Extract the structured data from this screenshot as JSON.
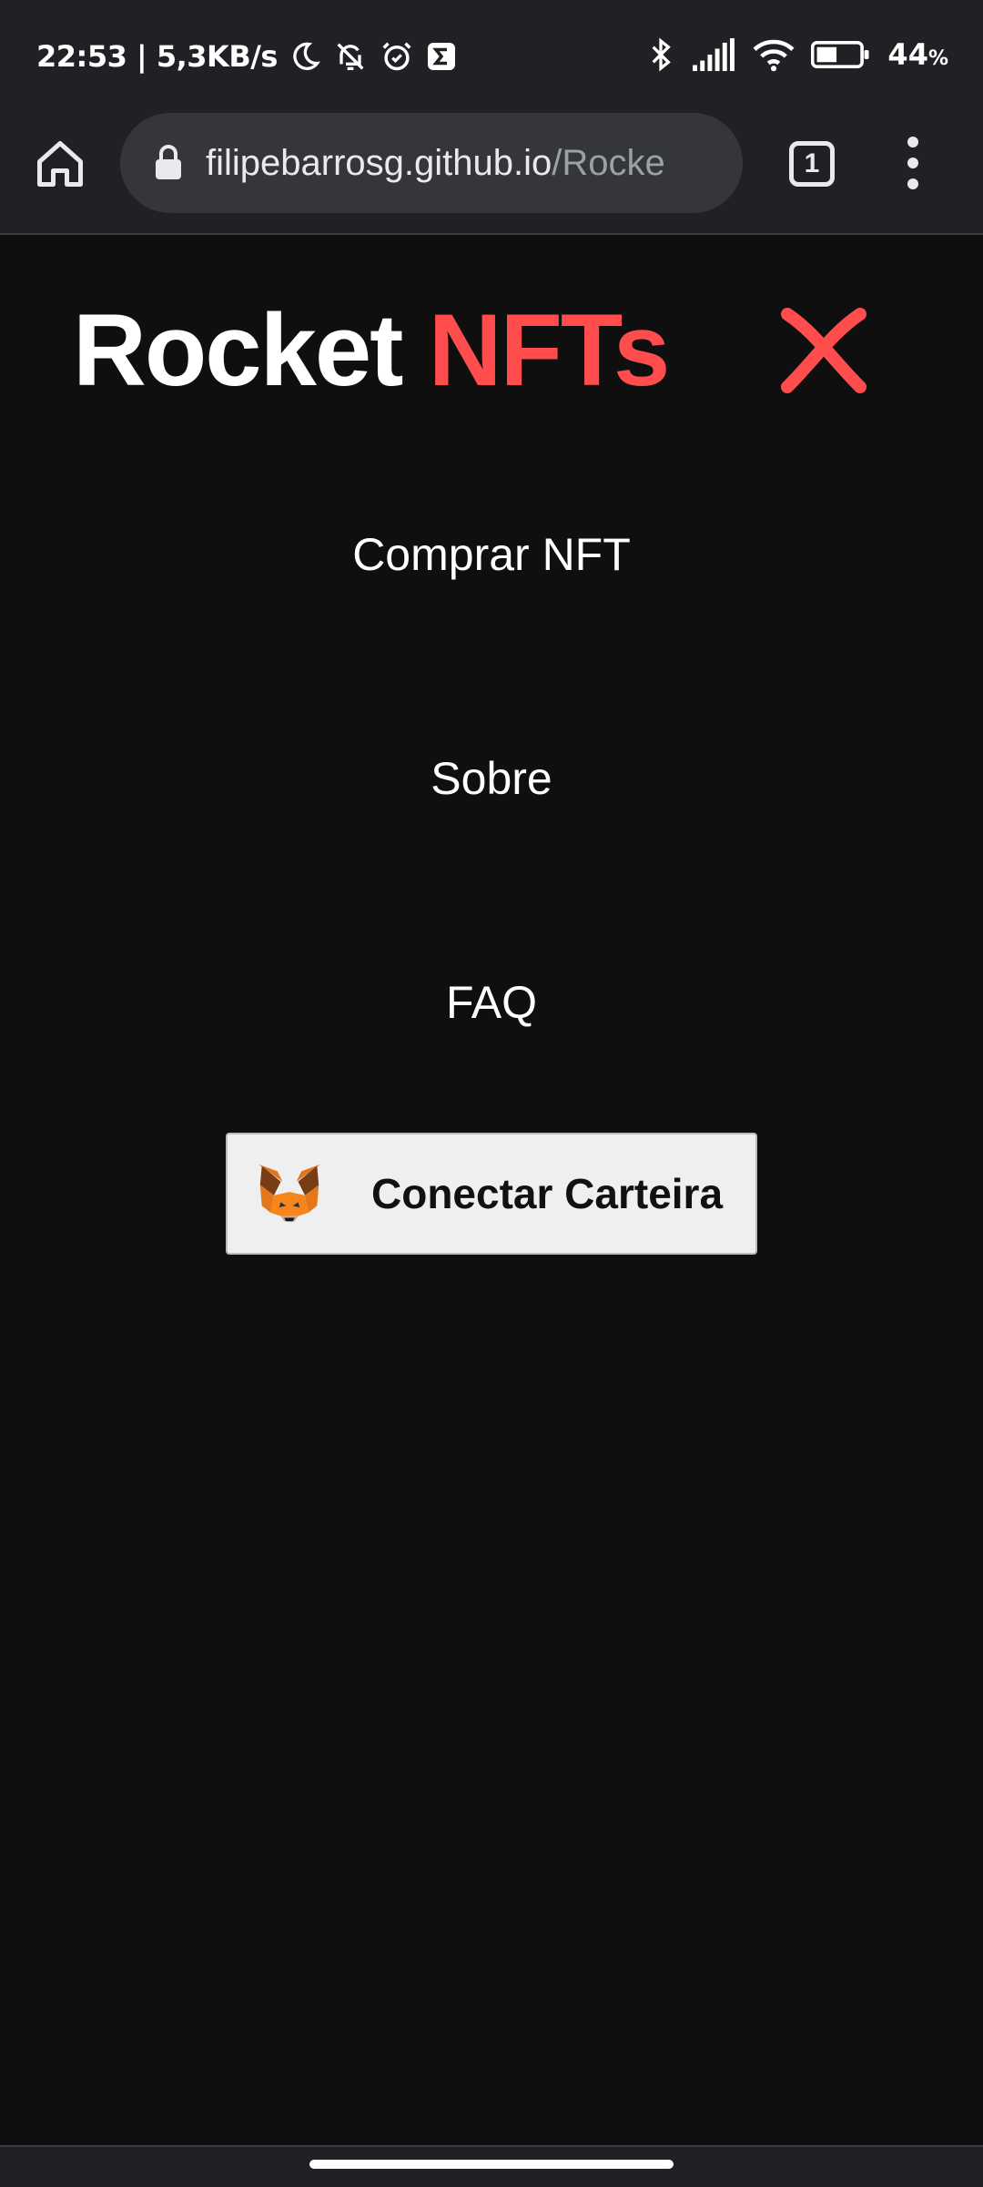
{
  "status_bar": {
    "time_speed": "22:53 | 5,3KB/s",
    "battery_pct": "44",
    "battery_unit": "%",
    "icons": [
      "moon-icon",
      "bell-off-icon",
      "alarm-icon",
      "app-sigma-icon",
      "bluetooth-icon",
      "signal-icon",
      "wifi-icon",
      "battery-icon"
    ]
  },
  "browser": {
    "url_host": "filipebarrosg.github.io",
    "url_path": "/Rocke",
    "tab_count": "1"
  },
  "site": {
    "brand_part1": "Rocket",
    "brand_part2": "NFTs",
    "accent_color": "#ff4d4d",
    "background_color": "#0f0f0f"
  },
  "menu": {
    "items": [
      {
        "label": "Comprar NFT"
      },
      {
        "label": "Sobre"
      },
      {
        "label": "FAQ"
      }
    ],
    "connect_label": "Conectar Carteira"
  }
}
